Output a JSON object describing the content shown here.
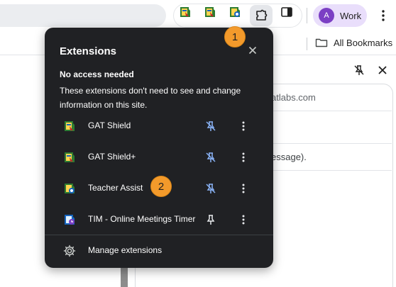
{
  "toolbar": {
    "extensions": [
      {
        "name": "gat-shield-extension",
        "icon": "gat-shield-icon"
      },
      {
        "name": "gat-shield-plus-extension",
        "icon": "gat-shield-plus-icon"
      },
      {
        "name": "teacher-assist-extension",
        "icon": "teacher-assist-icon"
      }
    ],
    "profile_initial": "A",
    "profile_name": "Work",
    "colors": {
      "avatar": "#7b3fc4",
      "profile_chip": "#e9defb"
    }
  },
  "bookmarks": {
    "all_bookmarks_label": "All Bookmarks"
  },
  "page": {
    "url_fragment": "atlabs.com",
    "message_fragment": "essage)."
  },
  "popup": {
    "title": "Extensions",
    "section_heading": "No access needed",
    "section_description": "These extensions don't need to see and change information on this site.",
    "extensions": [
      {
        "name": "GAT Shield",
        "pinned": true
      },
      {
        "name": "GAT Shield+",
        "pinned": true
      },
      {
        "name": "Teacher Assist",
        "pinned": true
      },
      {
        "name": "TIM - Online Meetings Timer",
        "pinned": false
      }
    ],
    "manage_label": "Manage extensions",
    "colors": {
      "background": "#202124",
      "pin_active": "#8ab4f8"
    }
  },
  "steps": {
    "step1": "1",
    "step2": "2",
    "color": "#f39a2b"
  }
}
